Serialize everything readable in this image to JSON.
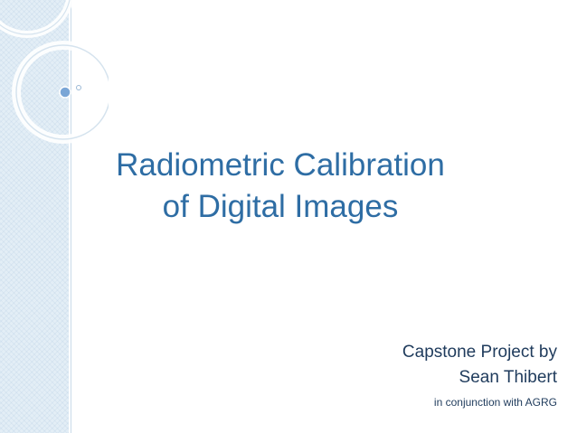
{
  "slide": {
    "title_line1": "Radiometric Calibration",
    "title_line2": "of Digital Images",
    "subtitle_line1": "Capstone Project by",
    "subtitle_line2": "Sean Thibert",
    "subtitle_line3": "in conjunction with AGRG"
  },
  "colors": {
    "title": "#2e6da4",
    "subtitle": "#1f3b5c",
    "band": "#e3eef6",
    "ornament_dot": "#7aa6d6"
  },
  "icons": [
    "circle-ornament-icon",
    "dot-ornament-icon"
  ]
}
